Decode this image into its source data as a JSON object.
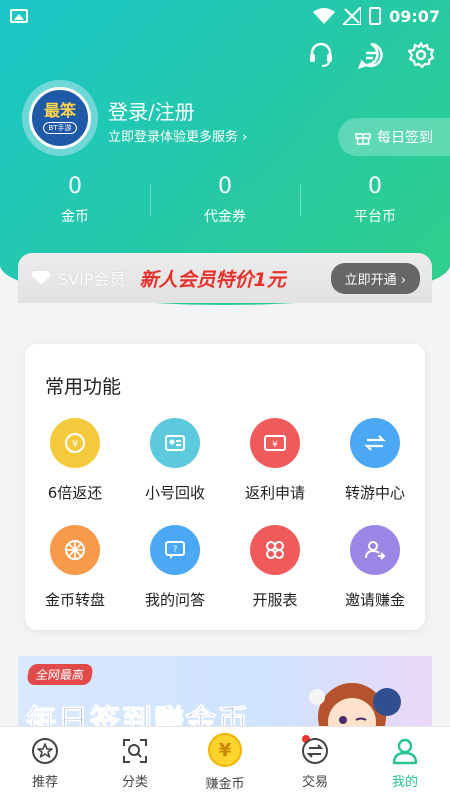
{
  "status": {
    "time": "09:07"
  },
  "profile": {
    "avatar_line1": "最笨",
    "avatar_line2": "BT手游",
    "login_title": "登录/注册",
    "login_sub": "立即登录体验更多服务 ›",
    "checkin_label": "每日签到"
  },
  "stats": [
    {
      "value": "0",
      "label": "金币"
    },
    {
      "value": "0",
      "label": "代金券"
    },
    {
      "value": "0",
      "label": "平台币"
    }
  ],
  "svip": {
    "label": "SVIP会员",
    "promo": "新人会员特价1元",
    "button": "立即开通 ›"
  },
  "functions": {
    "title": "常用功能",
    "items": [
      {
        "label": "6倍返还",
        "color": "#f5c93c",
        "icon": "coin-return-icon"
      },
      {
        "label": "小号回收",
        "color": "#5cc9dd",
        "icon": "id-card-icon"
      },
      {
        "label": "返利申请",
        "color": "#ef5a5a",
        "icon": "ticket-icon"
      },
      {
        "label": "转游中心",
        "color": "#4aa8f5",
        "icon": "transfer-icon"
      },
      {
        "label": "金币转盘",
        "color": "#f79a4a",
        "icon": "wheel-icon"
      },
      {
        "label": "我的问答",
        "color": "#4aa8f5",
        "icon": "qa-icon"
      },
      {
        "label": "开服表",
        "color": "#ef5a5a",
        "icon": "grid-icon"
      },
      {
        "label": "邀请赚金",
        "color": "#9b86e6",
        "icon": "invite-icon"
      }
    ]
  },
  "banner": {
    "tag": "全网最高",
    "text": "每日签到赚金币"
  },
  "tabs": [
    {
      "label": "推荐"
    },
    {
      "label": "分类"
    },
    {
      "label": "赚金币"
    },
    {
      "label": "交易"
    },
    {
      "label": "我的"
    }
  ],
  "colors": {
    "accent": "#27c48e",
    "promo_red": "#e8302a"
  }
}
